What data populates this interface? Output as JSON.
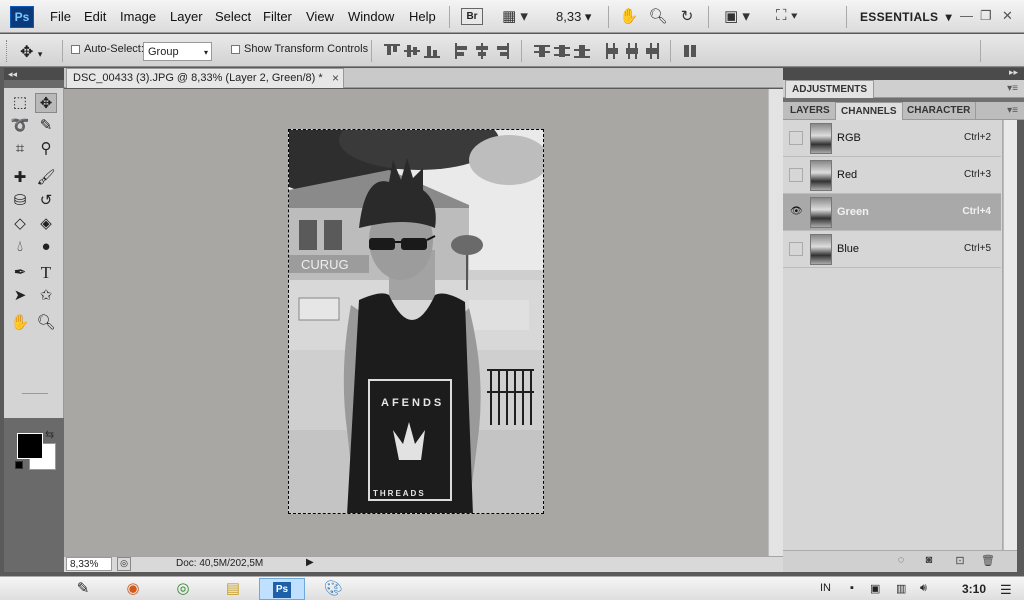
{
  "app": {
    "logo": "Ps",
    "colors": {
      "accent": "#0a3a7c",
      "canvas_bg": "#a8a7a3",
      "active_channel": "#a9a9a9"
    }
  },
  "menubar": {
    "items": [
      "File",
      "Edit",
      "Image",
      "Layer",
      "Select",
      "Filter",
      "View",
      "Window",
      "Help"
    ],
    "bridge_label": "Br",
    "zoom_value": "8,33",
    "workspace": "ESSENTIALS",
    "icons": [
      "bridge-icon",
      "screen-mode-icon",
      "hand-icon",
      "zoom-icon",
      "rotate-view-icon",
      "arrange-documents-icon",
      "screen-mode-icon"
    ]
  },
  "options": {
    "auto_select_label": "Auto-Select:",
    "auto_select_value": "Group",
    "show_transform_label": "Show Transform Controls"
  },
  "tools": {
    "foreground": "#000000",
    "background": "#ffffff",
    "items": [
      "marquee-tool",
      "move-tool",
      "lasso-tool",
      "quick-selection-tool",
      "crop-tool",
      "eyedropper-tool",
      "spot-healing-tool",
      "brush-tool",
      "clone-stamp-tool",
      "history-brush-tool",
      "eraser-tool",
      "paint-bucket-tool",
      "blur-tool",
      "dodge-tool",
      "pen-tool",
      "type-tool",
      "path-selection-tool",
      "custom-shape-tool",
      "hand-tool",
      "zoom-tool"
    ]
  },
  "document": {
    "tab_title": "DSC_00433 (3).JPG @ 8,33% (Layer 2, Green/8) *",
    "close_label": "×",
    "zoom": "8,33%",
    "doc_info": "Doc: 40,5M/202,5M",
    "image_text": [
      "AFENDS",
      "THREADS",
      "CURUG"
    ]
  },
  "panels": {
    "adjustments_tab": "ADJUSTMENTS",
    "tabs": [
      "LAYERS",
      "CHANNELS",
      "CHARACTER"
    ],
    "active_tab": "CHANNELS",
    "channels": [
      {
        "name": "RGB",
        "shortcut": "Ctrl+2",
        "visible": false
      },
      {
        "name": "Red",
        "shortcut": "Ctrl+3",
        "visible": false
      },
      {
        "name": "Green",
        "shortcut": "Ctrl+4",
        "visible": true
      },
      {
        "name": "Blue",
        "shortcut": "Ctrl+5",
        "visible": false
      }
    ],
    "footer_icons": [
      "load-selection-icon",
      "save-selection-icon",
      "new-channel-icon",
      "delete-channel-icon"
    ]
  },
  "taskbar": {
    "apps": [
      "apple-icon",
      "inkscape-icon",
      "firefox-icon",
      "chrome-icon",
      "files-icon",
      "photoshop-icon",
      "paint-icon"
    ],
    "photoshop_label": "Ps",
    "language": "IN",
    "time": "3:10"
  }
}
